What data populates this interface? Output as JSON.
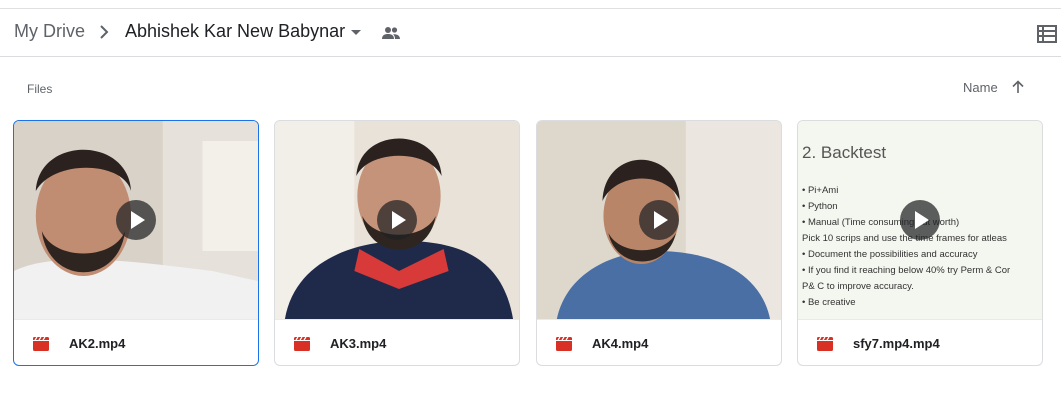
{
  "breadcrumb": {
    "root": "My Drive",
    "current": "Abhishek Kar New Babynar"
  },
  "section_label": "Files",
  "sort": {
    "label": "Name",
    "direction": "ascending"
  },
  "icons": {
    "separator": "chevron-right-icon",
    "folder_menu": "caret-down-icon",
    "shared": "people-icon",
    "view": "list-view-icon",
    "sort": "arrow-up-icon",
    "file": "video-file-icon",
    "play": "play-icon"
  },
  "colors": {
    "selected_border": "#1a73e8",
    "video_icon": "#d93025"
  },
  "files": [
    {
      "name": "AK2.mp4",
      "selected": true
    },
    {
      "name": "AK3.mp4",
      "selected": false
    },
    {
      "name": "AK4.mp4",
      "selected": false
    },
    {
      "name": "sfy7.mp4.mp4",
      "selected": false
    }
  ],
  "slide": {
    "title": "2. Backtest",
    "lines": [
      "• Pi+Ami",
      "• Python",
      "• Manual (Time consuming but worth)",
      "   Pick 10 scrips and use the time frames for atleas",
      "• Document the possibilities and accuracy",
      "• If you find it reaching below 40% try Perm & Cor",
      "   P& C to improve accuracy.",
      "• Be creative"
    ]
  }
}
